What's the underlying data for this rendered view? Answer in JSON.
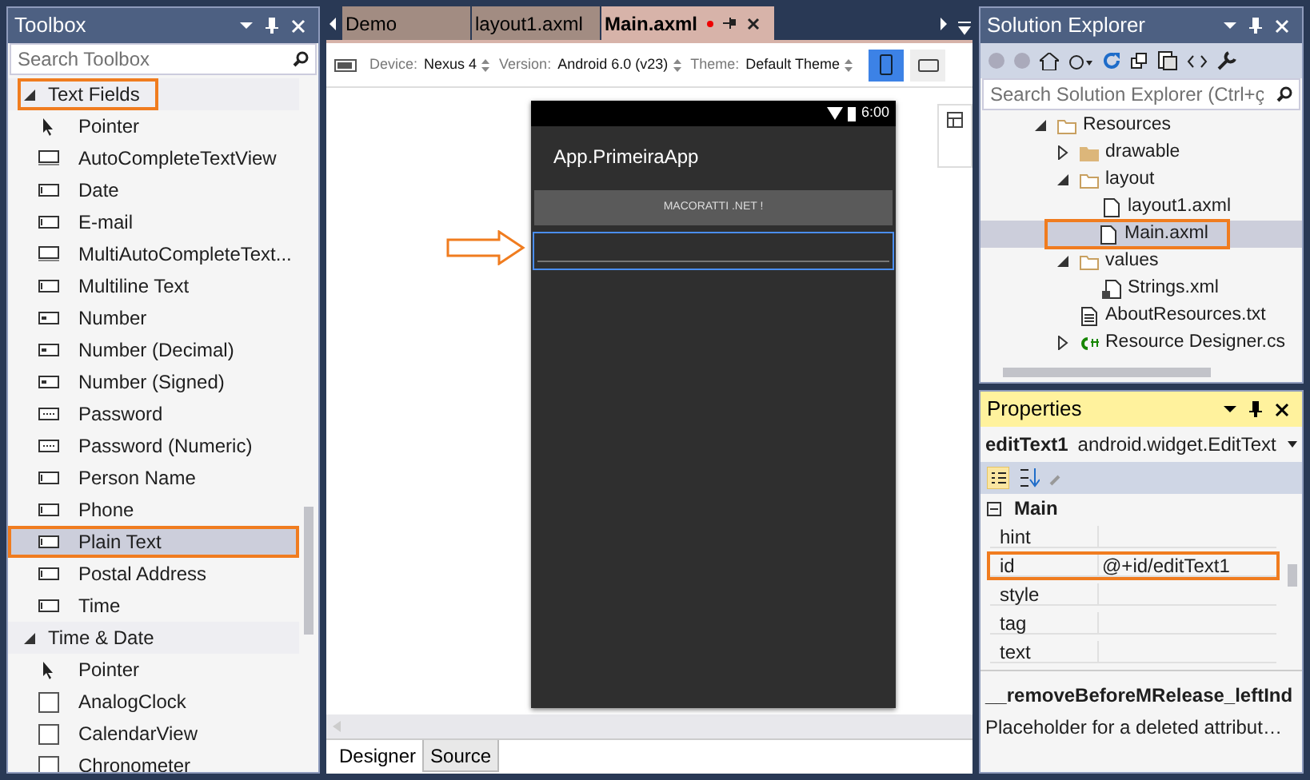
{
  "toolbox": {
    "title": "Toolbox",
    "search": {
      "placeholder": "Search Toolbox"
    },
    "groups": [
      {
        "label": "Text Fields",
        "expanded": true,
        "highlighted": true,
        "items": [
          {
            "label": "Pointer",
            "kind": "pointer",
            "selected": false,
            "highlighted": false
          },
          {
            "label": "AutoCompleteTextView",
            "kind": "multi",
            "selected": false,
            "highlighted": false
          },
          {
            "label": "Date",
            "kind": "field",
            "selected": false,
            "highlighted": false
          },
          {
            "label": "E-mail",
            "kind": "field",
            "selected": false,
            "highlighted": false
          },
          {
            "label": "MultiAutoCompleteText...",
            "kind": "multi",
            "selected": false,
            "highlighted": false
          },
          {
            "label": "Multiline Text",
            "kind": "field",
            "selected": false,
            "highlighted": false
          },
          {
            "label": "Number",
            "kind": "number",
            "selected": false,
            "highlighted": false
          },
          {
            "label": "Number (Decimal)",
            "kind": "number",
            "selected": false,
            "highlighted": false
          },
          {
            "label": "Number (Signed)",
            "kind": "number",
            "selected": false,
            "highlighted": false
          },
          {
            "label": "Password",
            "kind": "password",
            "selected": false,
            "highlighted": false
          },
          {
            "label": "Password (Numeric)",
            "kind": "password",
            "selected": false,
            "highlighted": false
          },
          {
            "label": "Person Name",
            "kind": "field",
            "selected": false,
            "highlighted": false
          },
          {
            "label": "Phone",
            "kind": "field",
            "selected": false,
            "highlighted": false
          },
          {
            "label": "Plain Text",
            "kind": "field",
            "selected": true,
            "highlighted": true
          },
          {
            "label": "Postal Address",
            "kind": "field",
            "selected": false,
            "highlighted": false
          },
          {
            "label": "Time",
            "kind": "field",
            "selected": false,
            "highlighted": false
          }
        ]
      },
      {
        "label": "Time & Date",
        "expanded": true,
        "highlighted": false,
        "items": [
          {
            "label": "Pointer",
            "kind": "pointer",
            "selected": false,
            "highlighted": false
          },
          {
            "label": "AnalogClock",
            "kind": "widget",
            "selected": false,
            "highlighted": false
          },
          {
            "label": "CalendarView",
            "kind": "widget",
            "selected": false,
            "highlighted": false
          },
          {
            "label": "Chronometer",
            "kind": "widget",
            "selected": false,
            "highlighted": false
          }
        ]
      }
    ]
  },
  "editor": {
    "tabs": [
      {
        "label": "Demo",
        "selected": false,
        "modified": false
      },
      {
        "label": "layout1.axml",
        "selected": false,
        "modified": false
      },
      {
        "label": "Main.axml",
        "selected": true,
        "modified": true
      }
    ],
    "toolbar": [
      {
        "label": "Device:",
        "value": "Nexus 4"
      },
      {
        "label": "Version:",
        "value": "Android 6.0 (v23)"
      },
      {
        "label": "Theme:",
        "value": "Default Theme"
      }
    ],
    "orientation": [
      {
        "kind": "portrait",
        "selected": true
      },
      {
        "kind": "landscape",
        "selected": false
      }
    ],
    "phone": {
      "time": "6:00",
      "app_title": "App.PrimeiraApp",
      "button": "MACORATTI .NET !",
      "edit_text": {
        "selected": true
      }
    },
    "bottom_tabs": [
      {
        "label": "Designer",
        "selected": true
      },
      {
        "label": "Source",
        "selected": false
      }
    ]
  },
  "solution_explorer": {
    "title": "Solution Explorer",
    "search": {
      "placeholder": "Search Solution Explorer (Ctrl+ç"
    },
    "tree": [
      {
        "label": "Resources",
        "kind": "folder",
        "expanded": true,
        "selected": false,
        "children": [
          {
            "label": "drawable",
            "kind": "closed-folder",
            "expanded": false,
            "selected": false
          },
          {
            "label": "layout",
            "kind": "folder",
            "expanded": true,
            "selected": false,
            "children": [
              {
                "label": "layout1.axml",
                "kind": "file",
                "selected": false
              },
              {
                "label": "Main.axml",
                "kind": "file",
                "selected": true
              }
            ]
          },
          {
            "label": "values",
            "kind": "folder",
            "expanded": true,
            "selected": false,
            "children": [
              {
                "label": "Strings.xml",
                "kind": "resource",
                "selected": false
              }
            ]
          },
          {
            "label": "AboutResources.txt",
            "kind": "text",
            "selected": false
          },
          {
            "label": "Resource Designer.cs",
            "kind": "csharp",
            "expanded": false,
            "selected": false
          }
        ]
      }
    ]
  },
  "properties": {
    "title": "Properties",
    "object": "editText1",
    "type": "android.widget.EditText",
    "category": {
      "label": "Main",
      "expanded": true
    },
    "rows": [
      {
        "name": "hint",
        "value": "",
        "highlighted": false
      },
      {
        "name": "id",
        "value": "@+id/editText1",
        "highlighted": true
      },
      {
        "name": "style",
        "value": "",
        "highlighted": false
      },
      {
        "name": "tag",
        "value": "",
        "highlighted": false
      },
      {
        "name": "text",
        "value": "",
        "highlighted": false
      }
    ],
    "description": {
      "title": "__removeBeforeMRelease_leftInd",
      "text": "Placeholder for a deleted attribut…"
    }
  }
}
